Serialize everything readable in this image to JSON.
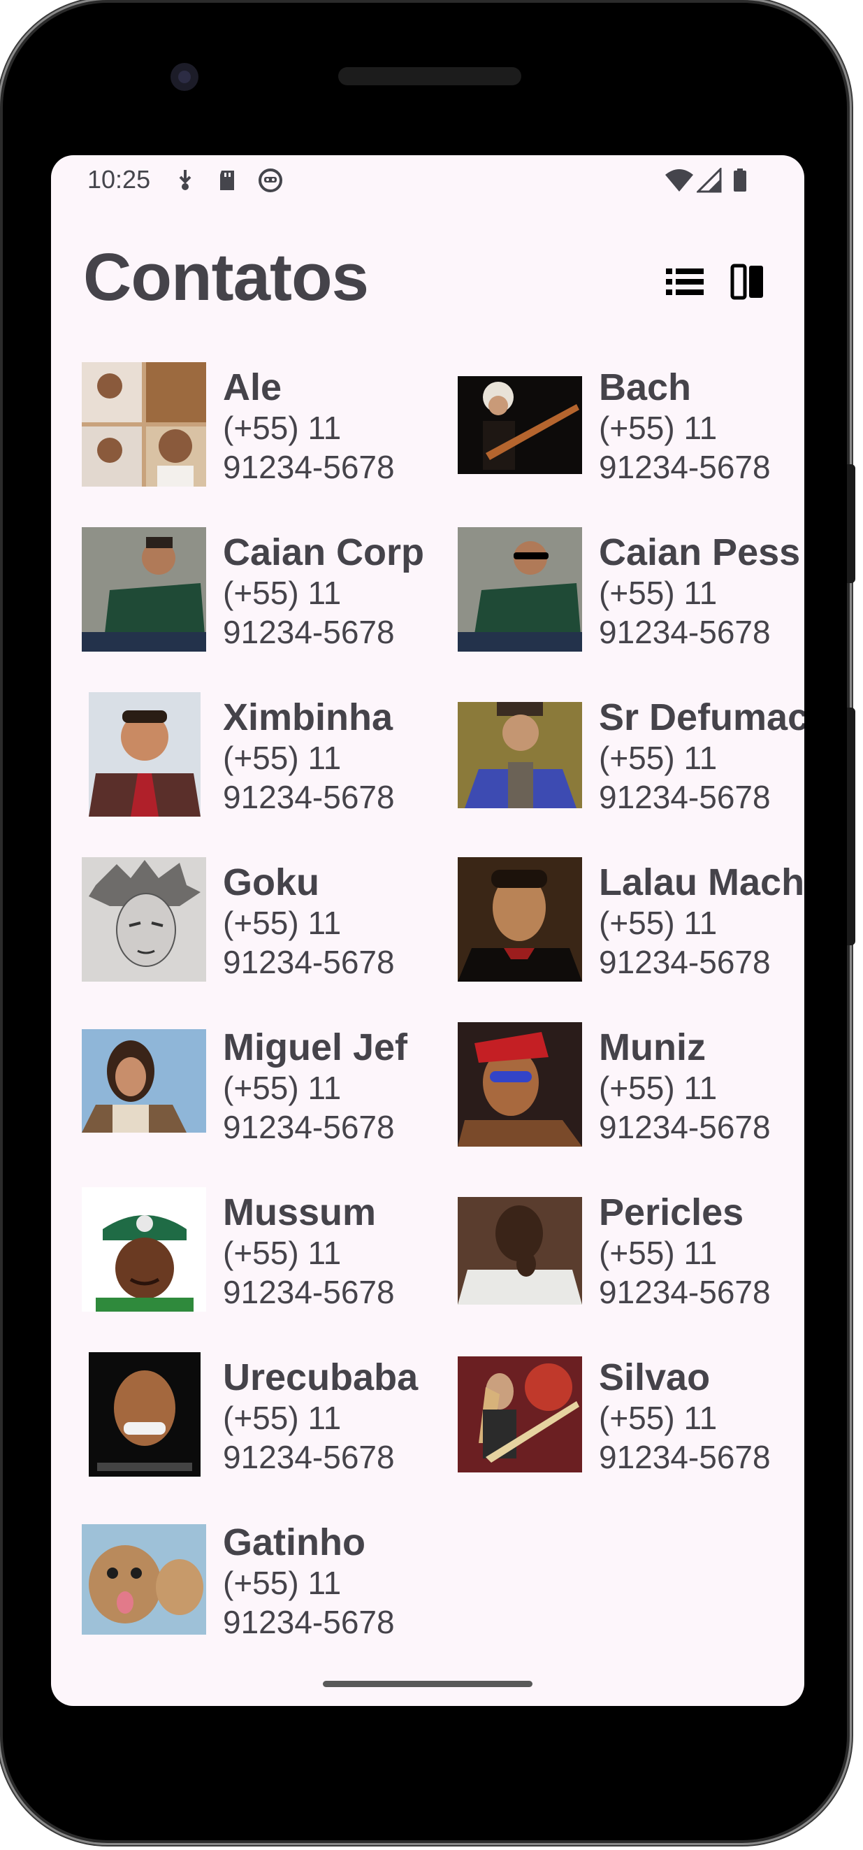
{
  "status_bar": {
    "time": "10:25"
  },
  "header": {
    "title": "Contatos"
  },
  "toolbar": {
    "list_view_icon": "list-view-icon",
    "grid_view_icon": "grid-view-icon"
  },
  "contacts": [
    {
      "name": "Ale",
      "phone_line1": "(+55) 11",
      "phone_line2": "91234-5678"
    },
    {
      "name": "Bach",
      "phone_line1": "(+55) 11",
      "phone_line2": "91234-5678"
    },
    {
      "name": "Caian Corp",
      "phone_line1": "(+55) 11",
      "phone_line2": "91234-5678"
    },
    {
      "name": "Caian Pess",
      "phone_line1": "(+55) 11",
      "phone_line2": "91234-5678"
    },
    {
      "name": "Ximbinha",
      "phone_line1": "(+55) 11",
      "phone_line2": "91234-5678"
    },
    {
      "name": "Sr Defumac",
      "phone_line1": "(+55) 11",
      "phone_line2": "91234-5678"
    },
    {
      "name": "Goku",
      "phone_line1": "(+55) 11",
      "phone_line2": "91234-5678"
    },
    {
      "name": "Lalau Mach",
      "phone_line1": "(+55) 11",
      "phone_line2": "91234-5678"
    },
    {
      "name": "Miguel Jef",
      "phone_line1": "(+55) 11",
      "phone_line2": "91234-5678"
    },
    {
      "name": "Muniz",
      "phone_line1": "(+55) 11",
      "phone_line2": "91234-5678"
    },
    {
      "name": "Mussum",
      "phone_line1": "(+55) 11",
      "phone_line2": "91234-5678"
    },
    {
      "name": "Pericles",
      "phone_line1": "(+55) 11",
      "phone_line2": "91234-5678"
    },
    {
      "name": "Urecubaba",
      "phone_line1": "(+55) 11",
      "phone_line2": "91234-5678"
    },
    {
      "name": "Silvao",
      "phone_line1": "(+55) 11",
      "phone_line2": "91234-5678"
    },
    {
      "name": "Gatinho",
      "phone_line1": "(+55) 11",
      "phone_line2": "91234-5678"
    }
  ],
  "colors": {
    "background": "#fdf6fb",
    "text": "#45434a"
  }
}
